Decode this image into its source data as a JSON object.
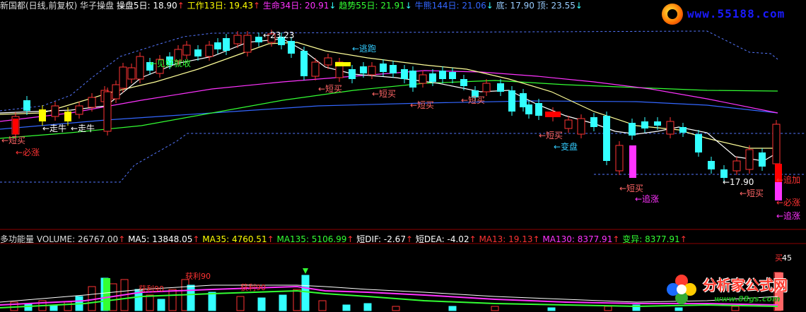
{
  "top_legend": [
    {
      "text": "新国都(日线,前复权)",
      "color": "#dddddd"
    },
    {
      "text": " 华子操盘  ",
      "color": "#dddddd"
    },
    {
      "text": "操盘5日: 18.90",
      "color": "#ffffff"
    },
    {
      "text": "↑",
      "color": "#ff3333"
    },
    {
      "text": "  工作13日: 19.43",
      "color": "#ffff00"
    },
    {
      "text": "↑",
      "color": "#ff3333"
    },
    {
      "text": "  生命34日: 20.91",
      "color": "#ff33ff"
    },
    {
      "text": "↓",
      "color": "#33ffff"
    },
    {
      "text": "  趋势55日: 21.91",
      "color": "#33ff33"
    },
    {
      "text": "↓",
      "color": "#33ffff"
    },
    {
      "text": "  牛熊144日: 21.06",
      "color": "#3366ff"
    },
    {
      "text": "↓",
      "color": "#33ffff"
    },
    {
      "text": "  底: 17.90  顶: 23.55",
      "color": "#99ccff"
    },
    {
      "text": "↓",
      "color": "#33ffff"
    }
  ],
  "vol_legend": [
    {
      "text": "多功能量 VOLUME: 26767.00",
      "color": "#dddddd"
    },
    {
      "text": "↑",
      "color": "#ff3333"
    },
    {
      "text": "   MA5: 13848.05",
      "color": "#ffffff"
    },
    {
      "text": "↑",
      "color": "#ff3333"
    },
    {
      "text": "   MA35: 4760.51",
      "color": "#ffff00"
    },
    {
      "text": "↑",
      "color": "#ff3333"
    },
    {
      "text": "   MA135: 5106.99",
      "color": "#33ff33"
    },
    {
      "text": "↑",
      "color": "#ff3333"
    },
    {
      "text": "              短DIF: -2.67",
      "color": "#ffffff"
    },
    {
      "text": "↑",
      "color": "#ff3333"
    },
    {
      "text": "   短DEA: -4.02",
      "color": "#ffffff"
    },
    {
      "text": "↑",
      "color": "#ff3333"
    },
    {
      "text": "   MA13: 19.13",
      "color": "#ff3333"
    },
    {
      "text": "↑",
      "color": "#ff3333"
    },
    {
      "text": "   MA130: 8377.91",
      "color": "#ff33ff"
    },
    {
      "text": "↑",
      "color": "#ff3333"
    },
    {
      "text": "   变异: 8377.91",
      "color": "#33ff33"
    },
    {
      "text": "↑",
      "color": "#ff3333"
    }
  ],
  "watermark_top": {
    "url": "www.55188.com"
  },
  "watermark_bottom": {
    "name": "分析家公式网",
    "site": "www.88gs.com"
  },
  "annotations": [
    {
      "text": "←短买",
      "color": "#ff6666",
      "kind": "signal"
    },
    {
      "text": "←必涨",
      "color": "#ff3333",
      "kind": "signal"
    },
    {
      "text": "←走牛",
      "color": "#ffffff",
      "kind": "signal"
    },
    {
      "text": "←走牛",
      "color": "#ffffff",
      "kind": "signal"
    },
    {
      "text": "←见好就收",
      "color": "#33ff33",
      "kind": "signal"
    },
    {
      "text": "←23.23",
      "color": "#ffffff",
      "kind": "price"
    },
    {
      "text": "←逃跑",
      "color": "#33ccff",
      "kind": "signal"
    },
    {
      "text": "←短买",
      "color": "#ff6666",
      "kind": "signal"
    },
    {
      "text": "←短买",
      "color": "#ff6666",
      "kind": "signal"
    },
    {
      "text": "←短买",
      "color": "#ff6666",
      "kind": "signal"
    },
    {
      "text": "←短买",
      "color": "#ff6666",
      "kind": "signal"
    },
    {
      "text": "←短买",
      "color": "#ff6666",
      "kind": "signal"
    },
    {
      "text": "←变盘",
      "color": "#33ccff",
      "kind": "signal"
    },
    {
      "text": "←短买",
      "color": "#ff6666",
      "kind": "signal"
    },
    {
      "text": "←追涨",
      "color": "#ff33ff",
      "kind": "signal"
    },
    {
      "text": "←17.90",
      "color": "#ffffff",
      "kind": "price"
    },
    {
      "text": "←短买",
      "color": "#ff6666",
      "kind": "signal"
    },
    {
      "text": "←追加",
      "color": "#ff3333",
      "kind": "signal"
    },
    {
      "text": "←必涨",
      "color": "#ff3333",
      "kind": "signal"
    },
    {
      "text": "←追涨",
      "color": "#ff33ff",
      "kind": "signal"
    }
  ],
  "volume_labels": [
    {
      "text": "获利90",
      "color": "#ff3333"
    },
    {
      "text": "获利90",
      "color": "#ff3333"
    },
    {
      "text": "获利90",
      "color": "#ff3333"
    },
    {
      "text": "买",
      "color": "#ff3333"
    },
    {
      "text": "45",
      "color": "#ffffff"
    }
  ],
  "colors": {
    "up": "#ff3333",
    "down": "#33ffff",
    "background": "#000000",
    "bull_bear": "#3366ff",
    "trend": "#33ff33",
    "life": "#ff33ff",
    "work": "#ffff99"
  }
}
